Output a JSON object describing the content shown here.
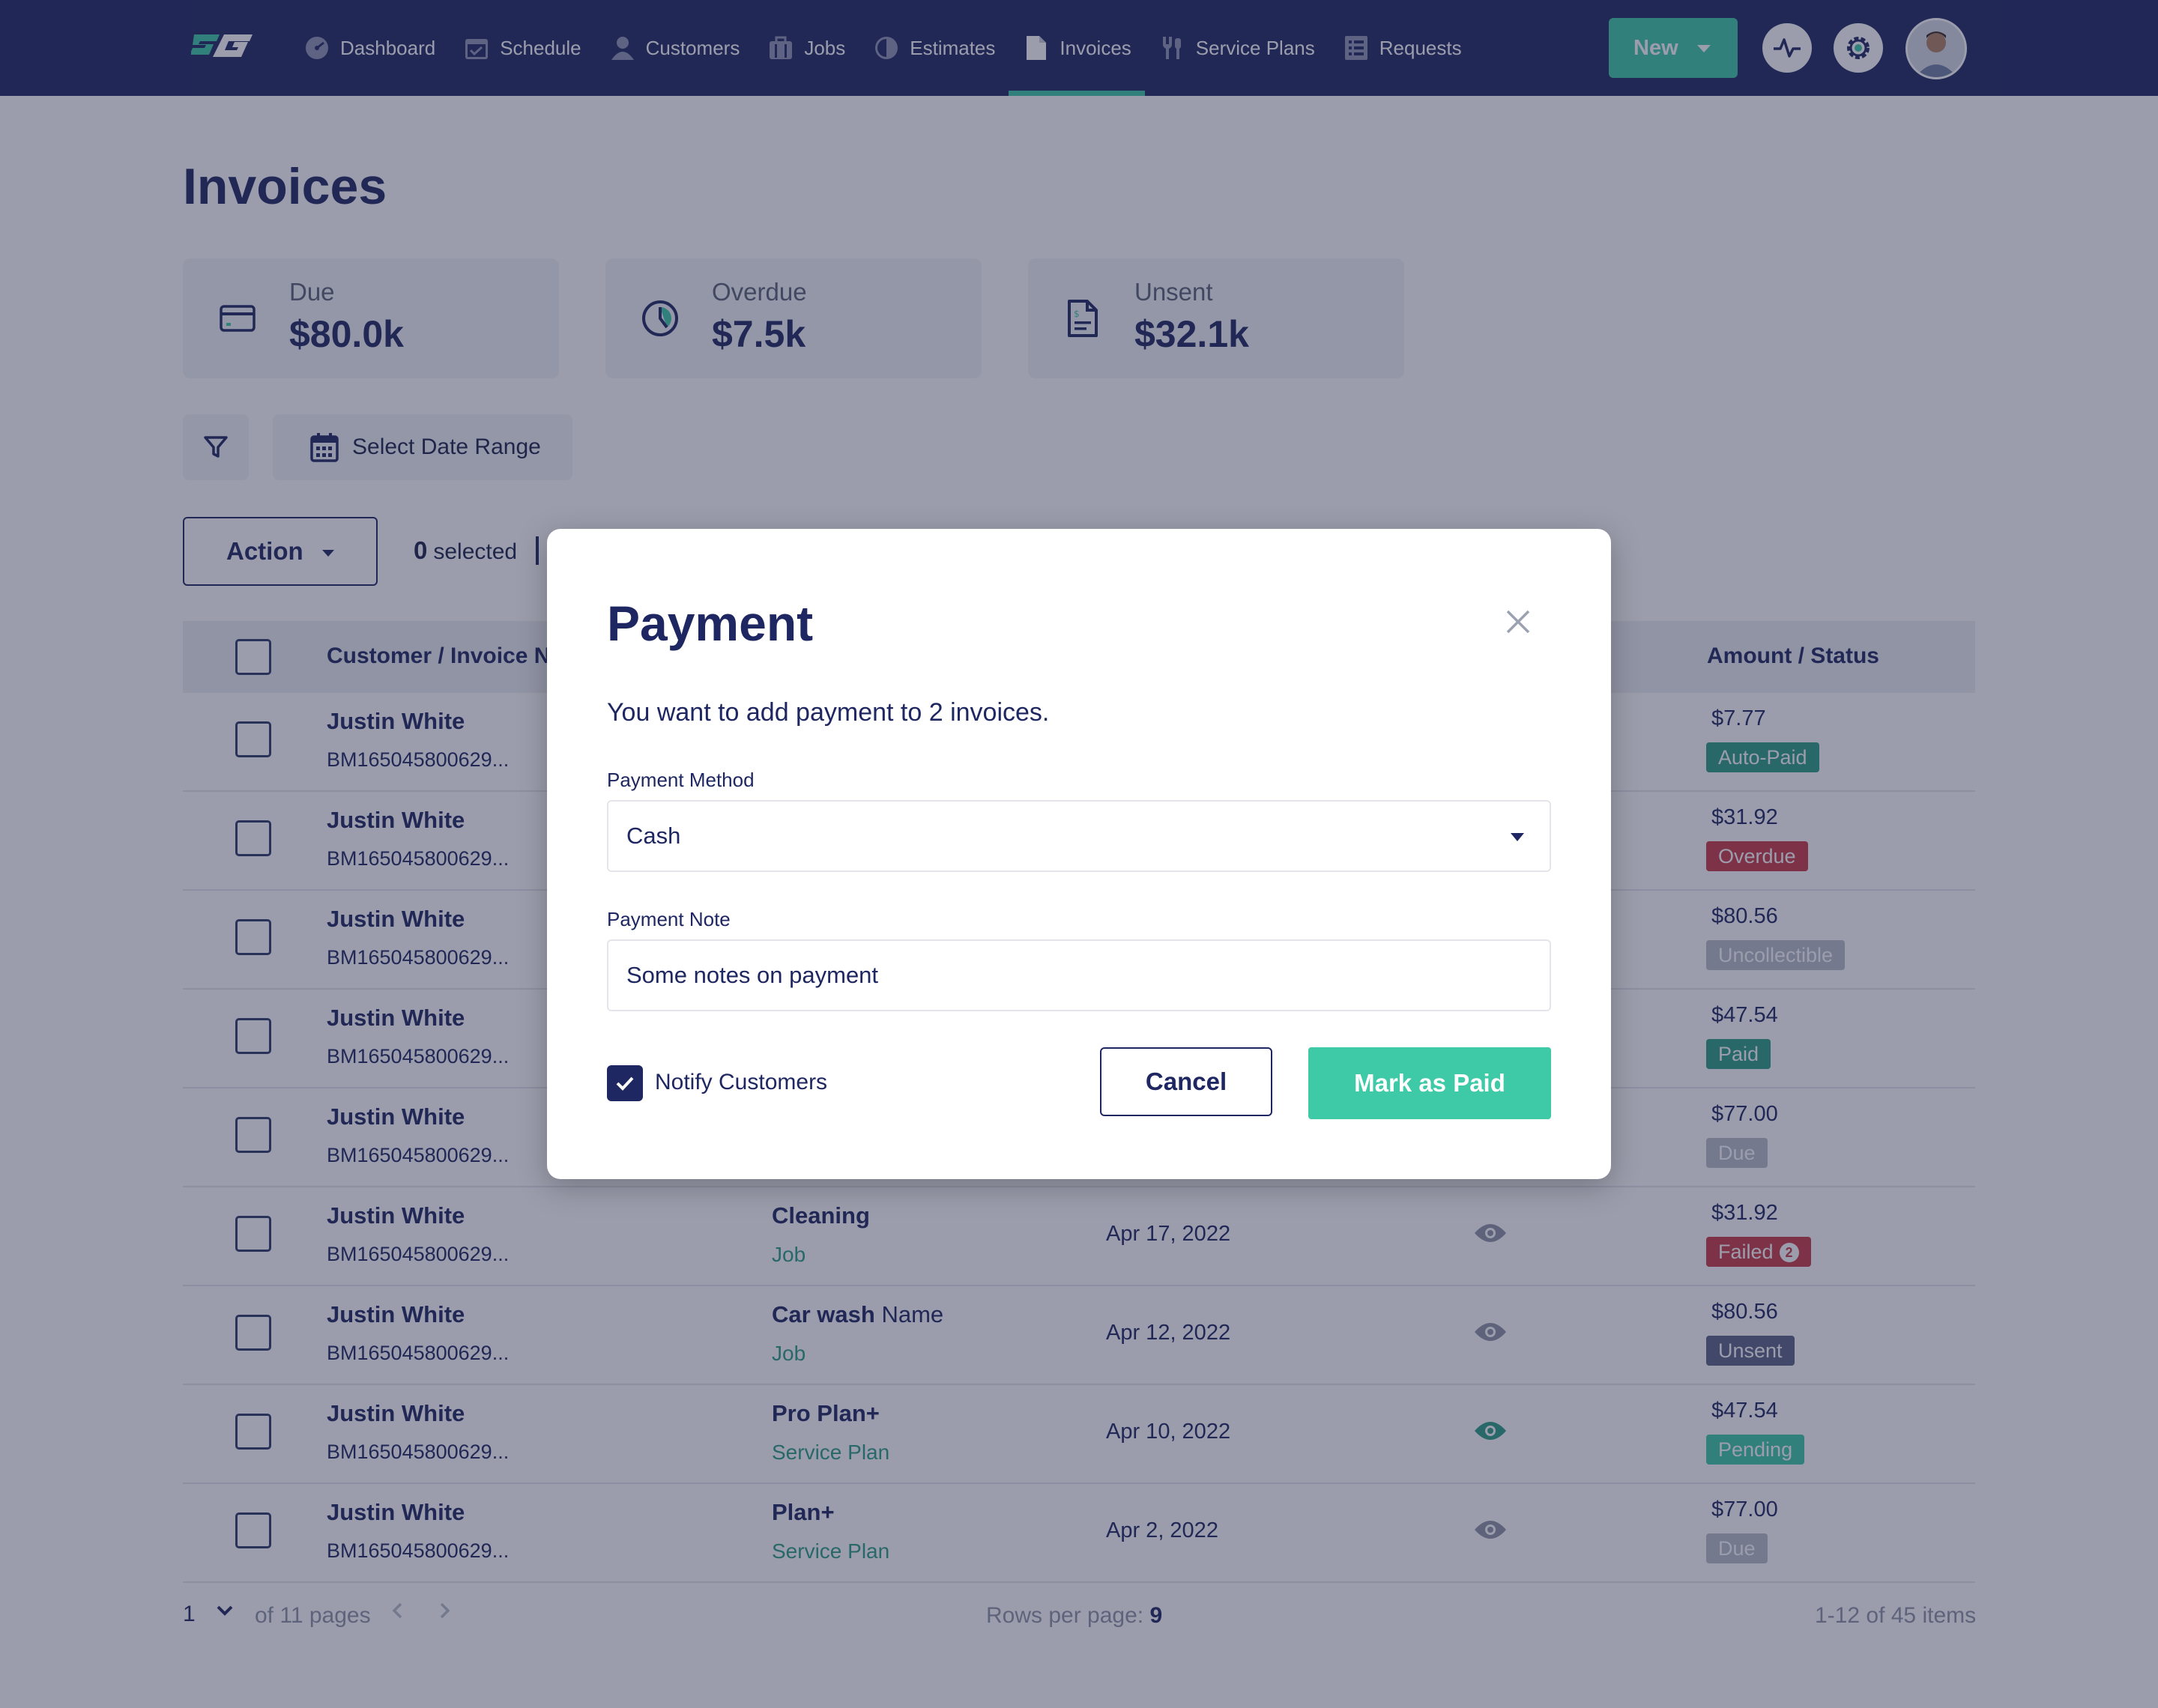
{
  "nav": {
    "items": [
      {
        "label": "Dashboard",
        "icon": "dashboard-icon"
      },
      {
        "label": "Schedule",
        "icon": "calendar-icon"
      },
      {
        "label": "Customers",
        "icon": "user-icon"
      },
      {
        "label": "Jobs",
        "icon": "briefcase-icon"
      },
      {
        "label": "Estimates",
        "icon": "estimate-icon"
      },
      {
        "label": "Invoices",
        "icon": "document-icon",
        "active": true
      },
      {
        "label": "Service Plans",
        "icon": "wrench-icon"
      },
      {
        "label": "Requests",
        "icon": "list-icon"
      }
    ],
    "new_label": "New"
  },
  "page": {
    "title": "Invoices",
    "stats": [
      {
        "label": "Due",
        "value": "$80.0k",
        "icon": "card-icon"
      },
      {
        "label": "Overdue",
        "value": "$7.5k",
        "icon": "clock-icon"
      },
      {
        "label": "Unsent",
        "value": "$32.1k",
        "icon": "invoice-icon"
      }
    ],
    "date_range_label": "Select Date Range",
    "action_label": "Action",
    "selected_count": "0",
    "selected_label": "selected"
  },
  "table": {
    "headers": {
      "customer": "Customer / Invoice Nu",
      "amount": "Amount / Status"
    },
    "rows": [
      {
        "name": "Justin White",
        "id": "BM165045800629...",
        "item_bold": "",
        "item_rest": "",
        "item_type": "",
        "date": "",
        "amount": "$7.77",
        "status": "Auto-Paid",
        "status_color": "#2b9e83",
        "eye_color": "#8f95a5"
      },
      {
        "name": "Justin White",
        "id": "BM165045800629...",
        "item_bold": "",
        "item_rest": "",
        "item_type": "",
        "date": "",
        "amount": "$31.92",
        "status": "Overdue",
        "status_color": "#c93a45",
        "eye_color": "#8f95a5"
      },
      {
        "name": "Justin White",
        "id": "BM165045800629...",
        "item_bold": "",
        "item_rest": "",
        "item_type": "",
        "date": "",
        "amount": "$80.56",
        "status": "Uncollectible",
        "status_color": "#b7bcc8",
        "eye_color": "#8f95a5"
      },
      {
        "name": "Justin White",
        "id": "BM165045800629...",
        "item_bold": "",
        "item_rest": "",
        "item_type": "",
        "date": "",
        "amount": "$47.54",
        "status": "Paid",
        "status_color": "#2b9e83",
        "eye_color": "#8f95a5"
      },
      {
        "name": "Justin White",
        "id": "BM165045800629...",
        "item_bold": "",
        "item_rest": "",
        "item_type": "",
        "date": "",
        "amount": "$77.00",
        "status": "Due",
        "status_color": "#b7bcc8",
        "eye_color": "#8f95a5"
      },
      {
        "name": "Justin White",
        "id": "BM165045800629...",
        "item_bold": "Cleaning",
        "item_rest": "",
        "item_type": "Job",
        "date": "Apr 17, 2022",
        "amount": "$31.92",
        "status": "Failed",
        "status_count": "2",
        "status_color": "#c93a45",
        "eye_color": "#8f95a5"
      },
      {
        "name": "Justin White",
        "id": "BM165045800629...",
        "item_bold": "Car wash",
        "item_rest": " Name",
        "item_type": "Job",
        "date": "Apr 12, 2022",
        "amount": "$80.56",
        "status": "Unsent",
        "status_color": "#5b6384",
        "eye_color": "#8f95a5"
      },
      {
        "name": "Justin White",
        "id": "BM165045800629...",
        "item_bold": "Pro Plan+",
        "item_rest": "",
        "item_type": "Service Plan",
        "date": "Apr 10, 2022",
        "amount": "$47.54",
        "status": "Pending",
        "status_color": "#3ec9a7",
        "eye_color": "#2b9e83"
      },
      {
        "name": "Justin White",
        "id": "BM165045800629...",
        "item_bold": "Plan+",
        "item_rest": "",
        "item_type": "Service Plan",
        "date": "Apr 2, 2022",
        "amount": "$77.00",
        "status": "Due",
        "status_color": "#b7bcc8",
        "eye_color": "#8f95a5"
      }
    ]
  },
  "pagination": {
    "current_page": "1",
    "of_pages": "of 11 pages",
    "rows_label": "Rows per page:",
    "rows_value": "9",
    "items_count": "1-12 of 45 items"
  },
  "modal": {
    "title": "Payment",
    "message": "You want to add payment to 2 invoices.",
    "method_label": "Payment Method",
    "method_value": "Cash",
    "note_label": "Payment Note",
    "note_value": "Some notes on payment",
    "notify_label": "Notify Customers",
    "notify_checked": true,
    "cancel_label": "Cancel",
    "confirm_label": "Mark as Paid"
  },
  "colors": {
    "navy": "#1e2761",
    "accent": "#3ec9a7",
    "danger": "#c93a45"
  }
}
